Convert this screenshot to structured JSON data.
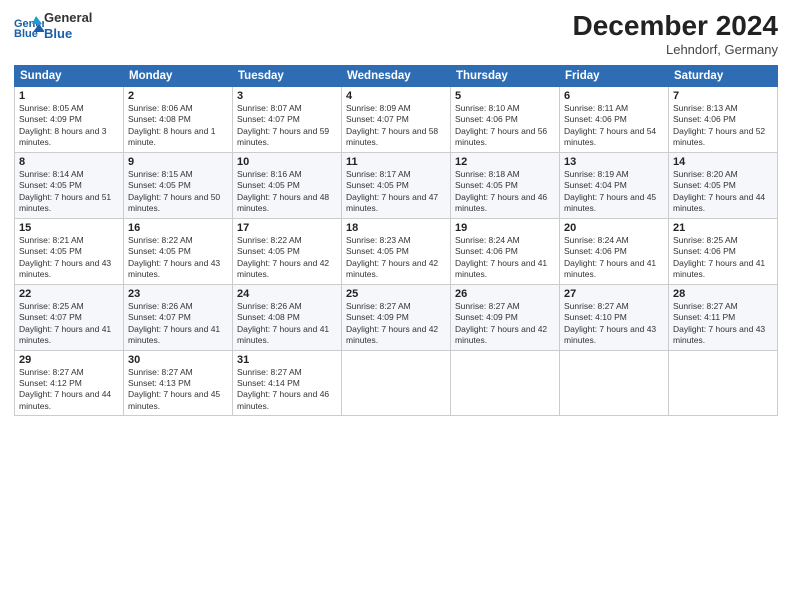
{
  "header": {
    "logo_line1": "General",
    "logo_line2": "Blue",
    "month": "December 2024",
    "location": "Lehndorf, Germany"
  },
  "days_of_week": [
    "Sunday",
    "Monday",
    "Tuesday",
    "Wednesday",
    "Thursday",
    "Friday",
    "Saturday"
  ],
  "weeks": [
    [
      {
        "day": 1,
        "sunrise": "Sunrise: 8:05 AM",
        "sunset": "Sunset: 4:09 PM",
        "daylight": "Daylight: 8 hours and 3 minutes."
      },
      {
        "day": 2,
        "sunrise": "Sunrise: 8:06 AM",
        "sunset": "Sunset: 4:08 PM",
        "daylight": "Daylight: 8 hours and 1 minute."
      },
      {
        "day": 3,
        "sunrise": "Sunrise: 8:07 AM",
        "sunset": "Sunset: 4:07 PM",
        "daylight": "Daylight: 7 hours and 59 minutes."
      },
      {
        "day": 4,
        "sunrise": "Sunrise: 8:09 AM",
        "sunset": "Sunset: 4:07 PM",
        "daylight": "Daylight: 7 hours and 58 minutes."
      },
      {
        "day": 5,
        "sunrise": "Sunrise: 8:10 AM",
        "sunset": "Sunset: 4:06 PM",
        "daylight": "Daylight: 7 hours and 56 minutes."
      },
      {
        "day": 6,
        "sunrise": "Sunrise: 8:11 AM",
        "sunset": "Sunset: 4:06 PM",
        "daylight": "Daylight: 7 hours and 54 minutes."
      },
      {
        "day": 7,
        "sunrise": "Sunrise: 8:13 AM",
        "sunset": "Sunset: 4:06 PM",
        "daylight": "Daylight: 7 hours and 52 minutes."
      }
    ],
    [
      {
        "day": 8,
        "sunrise": "Sunrise: 8:14 AM",
        "sunset": "Sunset: 4:05 PM",
        "daylight": "Daylight: 7 hours and 51 minutes."
      },
      {
        "day": 9,
        "sunrise": "Sunrise: 8:15 AM",
        "sunset": "Sunset: 4:05 PM",
        "daylight": "Daylight: 7 hours and 50 minutes."
      },
      {
        "day": 10,
        "sunrise": "Sunrise: 8:16 AM",
        "sunset": "Sunset: 4:05 PM",
        "daylight": "Daylight: 7 hours and 48 minutes."
      },
      {
        "day": 11,
        "sunrise": "Sunrise: 8:17 AM",
        "sunset": "Sunset: 4:05 PM",
        "daylight": "Daylight: 7 hours and 47 minutes."
      },
      {
        "day": 12,
        "sunrise": "Sunrise: 8:18 AM",
        "sunset": "Sunset: 4:05 PM",
        "daylight": "Daylight: 7 hours and 46 minutes."
      },
      {
        "day": 13,
        "sunrise": "Sunrise: 8:19 AM",
        "sunset": "Sunset: 4:04 PM",
        "daylight": "Daylight: 7 hours and 45 minutes."
      },
      {
        "day": 14,
        "sunrise": "Sunrise: 8:20 AM",
        "sunset": "Sunset: 4:05 PM",
        "daylight": "Daylight: 7 hours and 44 minutes."
      }
    ],
    [
      {
        "day": 15,
        "sunrise": "Sunrise: 8:21 AM",
        "sunset": "Sunset: 4:05 PM",
        "daylight": "Daylight: 7 hours and 43 minutes."
      },
      {
        "day": 16,
        "sunrise": "Sunrise: 8:22 AM",
        "sunset": "Sunset: 4:05 PM",
        "daylight": "Daylight: 7 hours and 43 minutes."
      },
      {
        "day": 17,
        "sunrise": "Sunrise: 8:22 AM",
        "sunset": "Sunset: 4:05 PM",
        "daylight": "Daylight: 7 hours and 42 minutes."
      },
      {
        "day": 18,
        "sunrise": "Sunrise: 8:23 AM",
        "sunset": "Sunset: 4:05 PM",
        "daylight": "Daylight: 7 hours and 42 minutes."
      },
      {
        "day": 19,
        "sunrise": "Sunrise: 8:24 AM",
        "sunset": "Sunset: 4:06 PM",
        "daylight": "Daylight: 7 hours and 41 minutes."
      },
      {
        "day": 20,
        "sunrise": "Sunrise: 8:24 AM",
        "sunset": "Sunset: 4:06 PM",
        "daylight": "Daylight: 7 hours and 41 minutes."
      },
      {
        "day": 21,
        "sunrise": "Sunrise: 8:25 AM",
        "sunset": "Sunset: 4:06 PM",
        "daylight": "Daylight: 7 hours and 41 minutes."
      }
    ],
    [
      {
        "day": 22,
        "sunrise": "Sunrise: 8:25 AM",
        "sunset": "Sunset: 4:07 PM",
        "daylight": "Daylight: 7 hours and 41 minutes."
      },
      {
        "day": 23,
        "sunrise": "Sunrise: 8:26 AM",
        "sunset": "Sunset: 4:07 PM",
        "daylight": "Daylight: 7 hours and 41 minutes."
      },
      {
        "day": 24,
        "sunrise": "Sunrise: 8:26 AM",
        "sunset": "Sunset: 4:08 PM",
        "daylight": "Daylight: 7 hours and 41 minutes."
      },
      {
        "day": 25,
        "sunrise": "Sunrise: 8:27 AM",
        "sunset": "Sunset: 4:09 PM",
        "daylight": "Daylight: 7 hours and 42 minutes."
      },
      {
        "day": 26,
        "sunrise": "Sunrise: 8:27 AM",
        "sunset": "Sunset: 4:09 PM",
        "daylight": "Daylight: 7 hours and 42 minutes."
      },
      {
        "day": 27,
        "sunrise": "Sunrise: 8:27 AM",
        "sunset": "Sunset: 4:10 PM",
        "daylight": "Daylight: 7 hours and 43 minutes."
      },
      {
        "day": 28,
        "sunrise": "Sunrise: 8:27 AM",
        "sunset": "Sunset: 4:11 PM",
        "daylight": "Daylight: 7 hours and 43 minutes."
      }
    ],
    [
      {
        "day": 29,
        "sunrise": "Sunrise: 8:27 AM",
        "sunset": "Sunset: 4:12 PM",
        "daylight": "Daylight: 7 hours and 44 minutes."
      },
      {
        "day": 30,
        "sunrise": "Sunrise: 8:27 AM",
        "sunset": "Sunset: 4:13 PM",
        "daylight": "Daylight: 7 hours and 45 minutes."
      },
      {
        "day": 31,
        "sunrise": "Sunrise: 8:27 AM",
        "sunset": "Sunset: 4:14 PM",
        "daylight": "Daylight: 7 hours and 46 minutes."
      },
      null,
      null,
      null,
      null
    ]
  ]
}
